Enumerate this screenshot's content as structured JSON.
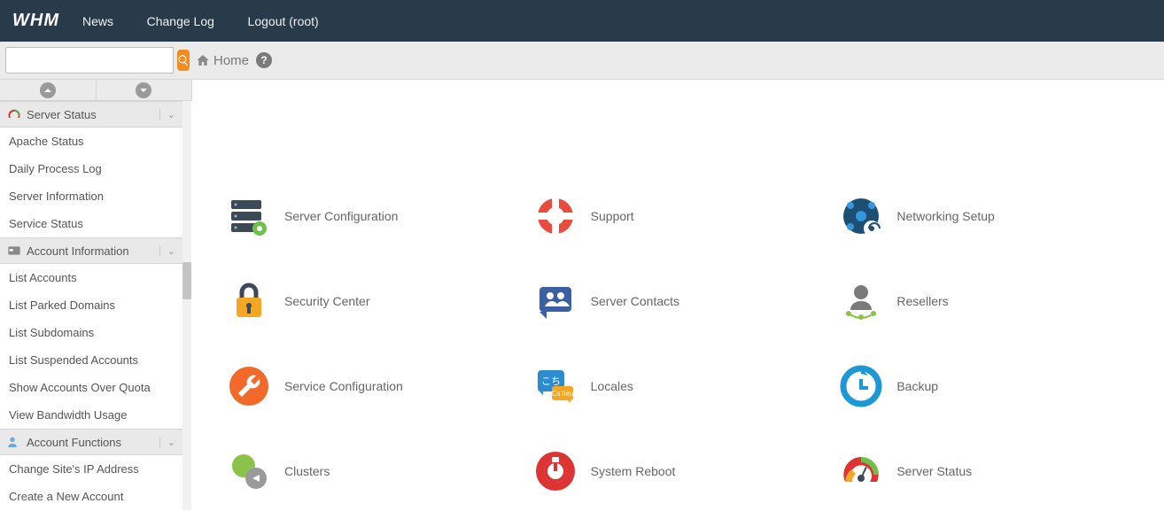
{
  "header": {
    "logo": "WHM",
    "nav": {
      "news": "News",
      "changelog": "Change Log",
      "logout": "Logout (root)"
    }
  },
  "search": {
    "placeholder": ""
  },
  "breadcrumb": {
    "home": "Home"
  },
  "sidebar": {
    "groups": [
      {
        "title": "Server Status",
        "items": [
          "Apache Status",
          "Daily Process Log",
          "Server Information",
          "Service Status"
        ]
      },
      {
        "title": "Account Information",
        "items": [
          "List Accounts",
          "List Parked Domains",
          "List Subdomains",
          "List Suspended Accounts",
          "Show Accounts Over Quota",
          "View Bandwidth Usage"
        ]
      },
      {
        "title": "Account Functions",
        "items": [
          "Change Site's IP Address",
          "Create a New Account"
        ]
      }
    ]
  },
  "tiles": [
    {
      "label": "Server Configuration"
    },
    {
      "label": "Support"
    },
    {
      "label": "Networking Setup"
    },
    {
      "label": "Security Center"
    },
    {
      "label": "Server Contacts"
    },
    {
      "label": "Resellers"
    },
    {
      "label": "Service Configuration"
    },
    {
      "label": "Locales"
    },
    {
      "label": "Backup"
    },
    {
      "label": "Clusters"
    },
    {
      "label": "System Reboot"
    },
    {
      "label": "Server Status"
    }
  ]
}
